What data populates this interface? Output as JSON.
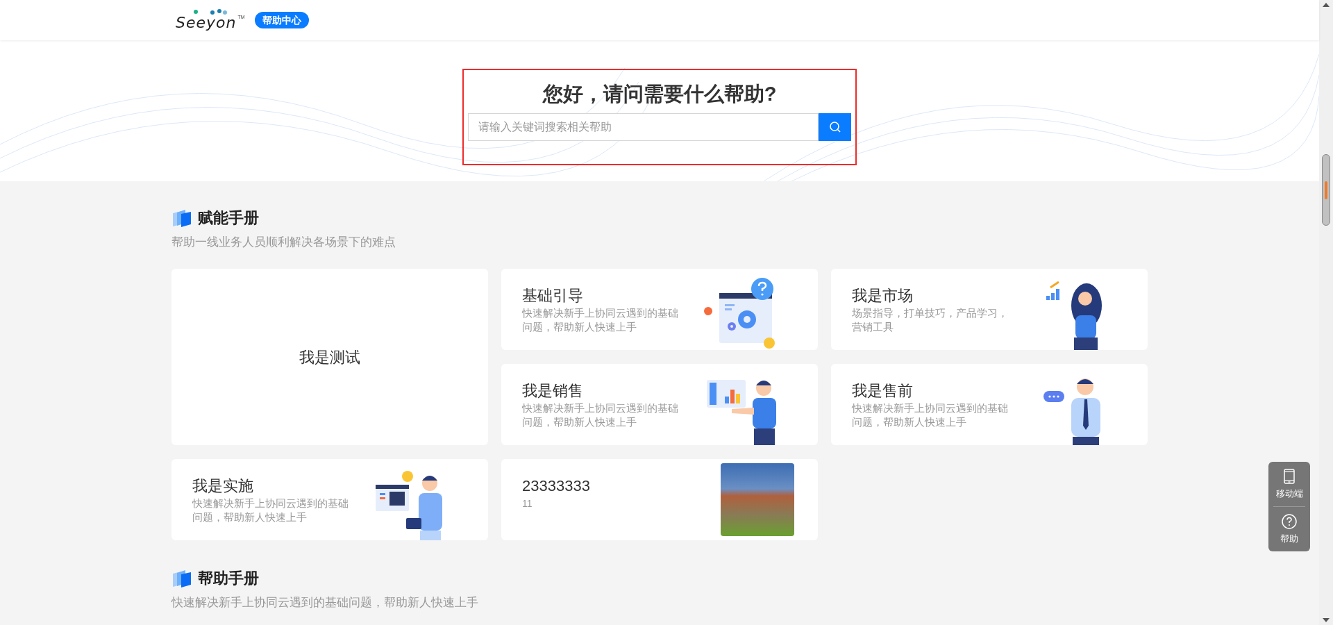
{
  "header": {
    "logo": "Seeyon",
    "trademark": "TM",
    "badge": "帮助中心"
  },
  "hero": {
    "title": "您好，请问需要什么帮助?",
    "search": {
      "placeholder": "请输入关键词搜索相关帮助"
    }
  },
  "sections": [
    {
      "title": "赋能手册",
      "subtitle": "帮助一线业务人员顺利解决各场景下的难点",
      "cards": [
        {
          "kind": "plain",
          "title": "我是测试"
        },
        {
          "kind": "illustrated",
          "title": "基础引导",
          "description": "快速解决新手上协同云遇到的基础问题，帮助新人快速上手"
        },
        {
          "kind": "illustrated",
          "title": "我是市场",
          "description": "场景指导，打单技巧，产品学习，营销工具"
        },
        {
          "kind": "illustrated",
          "title": "我是销售",
          "description": "快速解决新手上协同云遇到的基础问题，帮助新人快速上手"
        },
        {
          "kind": "illustrated",
          "title": "我是售前",
          "description": "快速解决新手上协同云遇到的基础问题，帮助新人快速上手"
        },
        {
          "kind": "illustrated",
          "title": "我是实施",
          "description": "快速解决新手上协同云遇到的基础问题，帮助新人快速上手"
        },
        {
          "kind": "photo",
          "title": "23333333",
          "description": "11"
        }
      ]
    },
    {
      "title": "帮助手册",
      "subtitle": "快速解决新手上协同云遇到的基础问题，帮助新人快速上手"
    }
  ],
  "float_panel": [
    {
      "kind": "mobile",
      "label": "移动端"
    },
    {
      "kind": "help",
      "label": "帮助"
    }
  ]
}
